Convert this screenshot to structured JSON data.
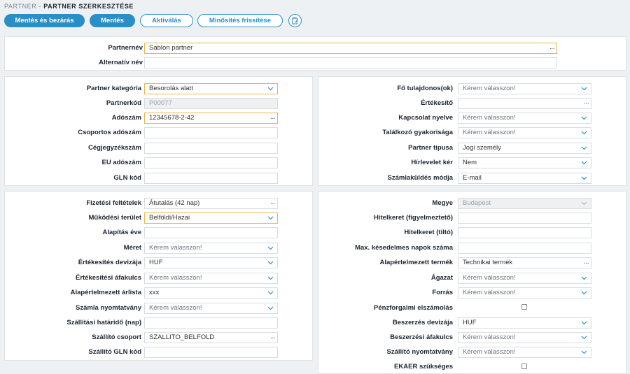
{
  "breadcrumb": {
    "parent": "PARTNER -",
    "current": "PARTNER SZERKESZTÉSE"
  },
  "toolbar": {
    "save_close": "Mentés és bezárás",
    "save": "Mentés",
    "activate": "Aktiválás",
    "refresh_rating": "Minősítés frissítése"
  },
  "colors": {
    "accent": "#2a8fc7",
    "highlight_border": "#e8b64a"
  },
  "general": {
    "partner_name_label": "Partnernév",
    "partner_name_value": "Sablon partner",
    "alt_name_label": "Alternatív név",
    "alt_name_value": ""
  },
  "left1": {
    "category_label": "Partner kategória",
    "category_value": "Besorolás alatt",
    "code_label": "Partnerkód",
    "code_value": "P00077",
    "tax_label": "Adószám",
    "tax_value": "12345678-2-42",
    "group_tax_label": "Csoportos adószám",
    "company_reg_label": "Cégjegyzékszám",
    "eu_tax_label": "EU adószám",
    "gln_label": "GLN kód"
  },
  "right1": {
    "owner_label": "Fő tulajdonos(ok)",
    "owner_value": "Kérem válasszon!",
    "sales_label": "Értékesítő",
    "sales_value": "",
    "lang_label": "Kapcsolat nyelve",
    "lang_value": "Kérem válasszon!",
    "meet_label": "Találkozó gyakorisága",
    "meet_value": "Kérem válasszon!",
    "type_label": "Partner típusa",
    "type_value": "Jogi személy",
    "news_label": "Hírlevelet kér",
    "news_value": "Nem",
    "invoice_label": "Számlaküldés módja",
    "invoice_value": "E-mail"
  },
  "left2": {
    "payment_label": "Fizetési feltételek",
    "payment_value": "Átutalás (42 nap)",
    "area_label": "Működési terület",
    "area_value": "Belföldi/Hazai",
    "founded_label": "Alapítás éve",
    "size_label": "Méret",
    "size_value": "Kérem válasszon!",
    "currency_label": "Értékesítés devizája",
    "currency_value": "HUF",
    "vat_label": "Értékesítési áfakulcs",
    "vat_value": "Kérem válasszon!",
    "pricelist_label": "Alapértelmezett árlista",
    "pricelist_value": "xxx",
    "print_label": "Számla nyomtatvány",
    "print_value": "Kérem válasszon!",
    "deadline_label": "Szállítási határidő (nap)",
    "ship_group_label": "Szállító csoport",
    "ship_group_value": "SZALLITO_BELFOLD",
    "ship_gln_label": "Szállító GLN kód"
  },
  "right2": {
    "county_label": "Megye",
    "county_value": "Budapest",
    "credit_warn_label": "Hitelkeret (figyelmeztető)",
    "credit_block_label": "Hitelkeret (tiltó)",
    "max_delay_label": "Max. késedelmes napok száma",
    "default_product_label": "Alapértelmezett termék",
    "default_product_value": "Technikai termék",
    "sector_label": "Ágazat",
    "sector_value": "Kérem válasszon!",
    "source_label": "Forrás",
    "source_value": "Kérem válasszon!",
    "cash_label": "Pénzforgalmi elszámolás",
    "purchase_currency_label": "Beszerzés devizája",
    "purchase_currency_value": "HUF",
    "purchase_vat_label": "Beszerzési áfakulcs",
    "purchase_vat_value": "Kérem válasszon!",
    "supplier_print_label": "Szállító nyomtatvány",
    "supplier_print_value": "Kérem válasszon!",
    "ekaer_label": "EKAER szükséges"
  }
}
